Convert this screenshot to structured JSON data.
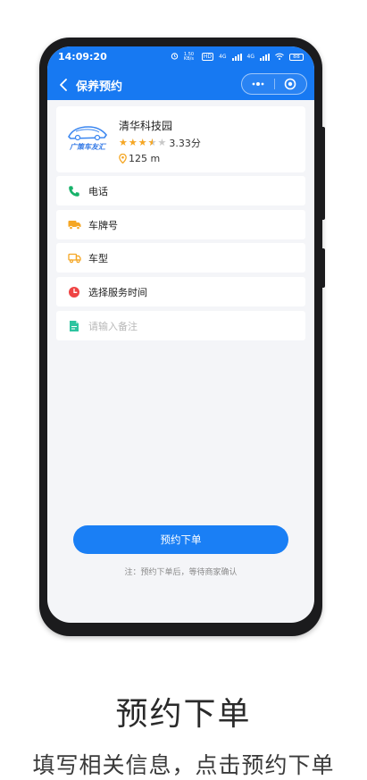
{
  "status_bar": {
    "time": "14:09:20",
    "net_speed": "1.50 KB/s",
    "hd_badge": "HD",
    "sim1": "4G",
    "sim2": "4G",
    "battery": "88"
  },
  "nav": {
    "title": "保养预约",
    "back_icon": "chevron-left-icon",
    "more_icon": "more-dots-icon",
    "close_icon": "target-icon"
  },
  "shop": {
    "logo_text": "广策车友汇",
    "name": "清华科技园",
    "rating": 3.33,
    "rating_text": "3.33分",
    "stars_filled": 3.5,
    "stars_total": 5,
    "distance": "125 m"
  },
  "form": {
    "fields": [
      {
        "label": "电话",
        "icon": "phone-icon",
        "color": "#17b26a"
      },
      {
        "label": "车牌号",
        "icon": "truck-icon",
        "color": "#f5a623"
      },
      {
        "label": "车型",
        "icon": "car-outline-icon",
        "color": "#f5a623"
      },
      {
        "label": "选择服务时间",
        "icon": "clock-icon",
        "color": "#ef4444"
      }
    ],
    "remark_placeholder": "请输入备注",
    "remark_icon": "document-icon",
    "remark_color": "#2ec4a0"
  },
  "submit": {
    "label": "预约下单",
    "note": "注：预约下单后，等待商家确认"
  },
  "caption": {
    "title": "预约下单",
    "subtitle": "填写相关信息，点击预约下单"
  },
  "colors": {
    "primary": "#1779f2",
    "background": "#f4f5f8",
    "star": "#f5a623"
  }
}
